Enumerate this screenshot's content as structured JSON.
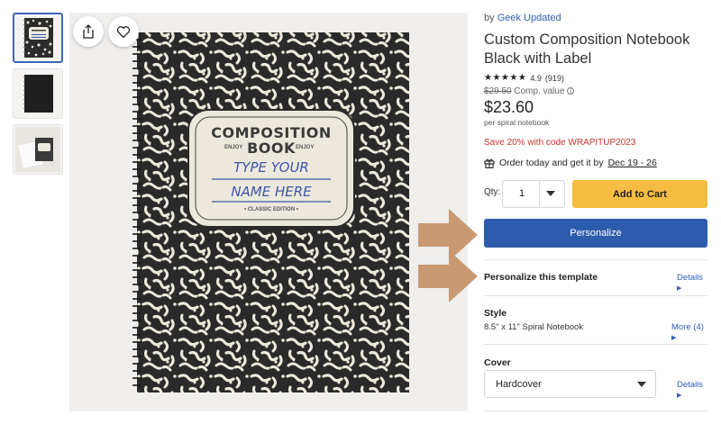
{
  "product": {
    "by_prefix": "by ",
    "brand": "Geek Updated",
    "title": "Custom Composition Notebook Black with Label",
    "stars": "★★★★★",
    "rating": "4.9",
    "review_count": "(919)",
    "original_price": "$29.50",
    "comp_value_label": "Comp. value",
    "price": "$23.60",
    "per_unit": "per spiral notebook",
    "promo": "Save 20% with code WRAPITUP2023",
    "delivery_text": "Order today and get it by",
    "delivery_dates": "Dec 19 - 26"
  },
  "cover_art": {
    "heading": "COMPOSITION",
    "subheading": "BOOK",
    "enjoy_left": "ENJOY",
    "enjoy_right": "ENJOY",
    "line1": "TYPE YOUR",
    "line2": "NAME HERE",
    "edition": "• CLASSIC EDITION •"
  },
  "purchase": {
    "qty_label": "Qty:",
    "qty_value": "1",
    "add_to_cart": "Add to Cart",
    "personalize": "Personalize"
  },
  "sections": {
    "personalize_title": "Personalize this template",
    "personalize_link": "Details",
    "style_title": "Style",
    "style_value": "8.5\" x 11\" Spiral Notebook",
    "style_link": "More (4)",
    "cover_title": "Cover",
    "cover_value": "Hardcover",
    "cover_link": "Details"
  },
  "icons": {
    "share": "share-icon",
    "favorite": "heart-icon",
    "gift": "gift-icon",
    "info": "info-icon",
    "caret": "chevron-down-icon",
    "link_chevron": "chevron-right-icon"
  },
  "colors": {
    "brand_blue": "#2e5cad",
    "add_to_cart_yellow": "#f4bc41",
    "promo_red": "#c6372f",
    "link_blue": "#2f5eb8",
    "arrow_tan": "#c99a72",
    "label_ink": "#3d55a8"
  }
}
